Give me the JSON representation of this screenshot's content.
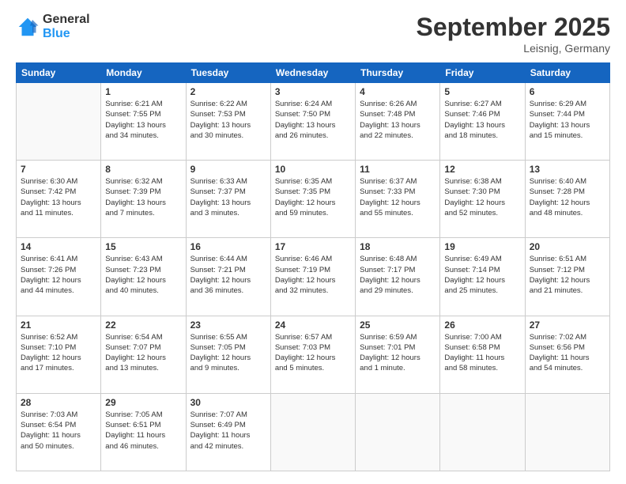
{
  "logo": {
    "general": "General",
    "blue": "Blue"
  },
  "header": {
    "month": "September 2025",
    "location": "Leisnig, Germany"
  },
  "weekdays": [
    "Sunday",
    "Monday",
    "Tuesday",
    "Wednesday",
    "Thursday",
    "Friday",
    "Saturday"
  ],
  "weeks": [
    [
      {
        "day": "",
        "info": ""
      },
      {
        "day": "1",
        "info": "Sunrise: 6:21 AM\nSunset: 7:55 PM\nDaylight: 13 hours\nand 34 minutes."
      },
      {
        "day": "2",
        "info": "Sunrise: 6:22 AM\nSunset: 7:53 PM\nDaylight: 13 hours\nand 30 minutes."
      },
      {
        "day": "3",
        "info": "Sunrise: 6:24 AM\nSunset: 7:50 PM\nDaylight: 13 hours\nand 26 minutes."
      },
      {
        "day": "4",
        "info": "Sunrise: 6:26 AM\nSunset: 7:48 PM\nDaylight: 13 hours\nand 22 minutes."
      },
      {
        "day": "5",
        "info": "Sunrise: 6:27 AM\nSunset: 7:46 PM\nDaylight: 13 hours\nand 18 minutes."
      },
      {
        "day": "6",
        "info": "Sunrise: 6:29 AM\nSunset: 7:44 PM\nDaylight: 13 hours\nand 15 minutes."
      }
    ],
    [
      {
        "day": "7",
        "info": "Sunrise: 6:30 AM\nSunset: 7:42 PM\nDaylight: 13 hours\nand 11 minutes."
      },
      {
        "day": "8",
        "info": "Sunrise: 6:32 AM\nSunset: 7:39 PM\nDaylight: 13 hours\nand 7 minutes."
      },
      {
        "day": "9",
        "info": "Sunrise: 6:33 AM\nSunset: 7:37 PM\nDaylight: 13 hours\nand 3 minutes."
      },
      {
        "day": "10",
        "info": "Sunrise: 6:35 AM\nSunset: 7:35 PM\nDaylight: 12 hours\nand 59 minutes."
      },
      {
        "day": "11",
        "info": "Sunrise: 6:37 AM\nSunset: 7:33 PM\nDaylight: 12 hours\nand 55 minutes."
      },
      {
        "day": "12",
        "info": "Sunrise: 6:38 AM\nSunset: 7:30 PM\nDaylight: 12 hours\nand 52 minutes."
      },
      {
        "day": "13",
        "info": "Sunrise: 6:40 AM\nSunset: 7:28 PM\nDaylight: 12 hours\nand 48 minutes."
      }
    ],
    [
      {
        "day": "14",
        "info": "Sunrise: 6:41 AM\nSunset: 7:26 PM\nDaylight: 12 hours\nand 44 minutes."
      },
      {
        "day": "15",
        "info": "Sunrise: 6:43 AM\nSunset: 7:23 PM\nDaylight: 12 hours\nand 40 minutes."
      },
      {
        "day": "16",
        "info": "Sunrise: 6:44 AM\nSunset: 7:21 PM\nDaylight: 12 hours\nand 36 minutes."
      },
      {
        "day": "17",
        "info": "Sunrise: 6:46 AM\nSunset: 7:19 PM\nDaylight: 12 hours\nand 32 minutes."
      },
      {
        "day": "18",
        "info": "Sunrise: 6:48 AM\nSunset: 7:17 PM\nDaylight: 12 hours\nand 29 minutes."
      },
      {
        "day": "19",
        "info": "Sunrise: 6:49 AM\nSunset: 7:14 PM\nDaylight: 12 hours\nand 25 minutes."
      },
      {
        "day": "20",
        "info": "Sunrise: 6:51 AM\nSunset: 7:12 PM\nDaylight: 12 hours\nand 21 minutes."
      }
    ],
    [
      {
        "day": "21",
        "info": "Sunrise: 6:52 AM\nSunset: 7:10 PM\nDaylight: 12 hours\nand 17 minutes."
      },
      {
        "day": "22",
        "info": "Sunrise: 6:54 AM\nSunset: 7:07 PM\nDaylight: 12 hours\nand 13 minutes."
      },
      {
        "day": "23",
        "info": "Sunrise: 6:55 AM\nSunset: 7:05 PM\nDaylight: 12 hours\nand 9 minutes."
      },
      {
        "day": "24",
        "info": "Sunrise: 6:57 AM\nSunset: 7:03 PM\nDaylight: 12 hours\nand 5 minutes."
      },
      {
        "day": "25",
        "info": "Sunrise: 6:59 AM\nSunset: 7:01 PM\nDaylight: 12 hours\nand 1 minute."
      },
      {
        "day": "26",
        "info": "Sunrise: 7:00 AM\nSunset: 6:58 PM\nDaylight: 11 hours\nand 58 minutes."
      },
      {
        "day": "27",
        "info": "Sunrise: 7:02 AM\nSunset: 6:56 PM\nDaylight: 11 hours\nand 54 minutes."
      }
    ],
    [
      {
        "day": "28",
        "info": "Sunrise: 7:03 AM\nSunset: 6:54 PM\nDaylight: 11 hours\nand 50 minutes."
      },
      {
        "day": "29",
        "info": "Sunrise: 7:05 AM\nSunset: 6:51 PM\nDaylight: 11 hours\nand 46 minutes."
      },
      {
        "day": "30",
        "info": "Sunrise: 7:07 AM\nSunset: 6:49 PM\nDaylight: 11 hours\nand 42 minutes."
      },
      {
        "day": "",
        "info": ""
      },
      {
        "day": "",
        "info": ""
      },
      {
        "day": "",
        "info": ""
      },
      {
        "day": "",
        "info": ""
      }
    ]
  ]
}
